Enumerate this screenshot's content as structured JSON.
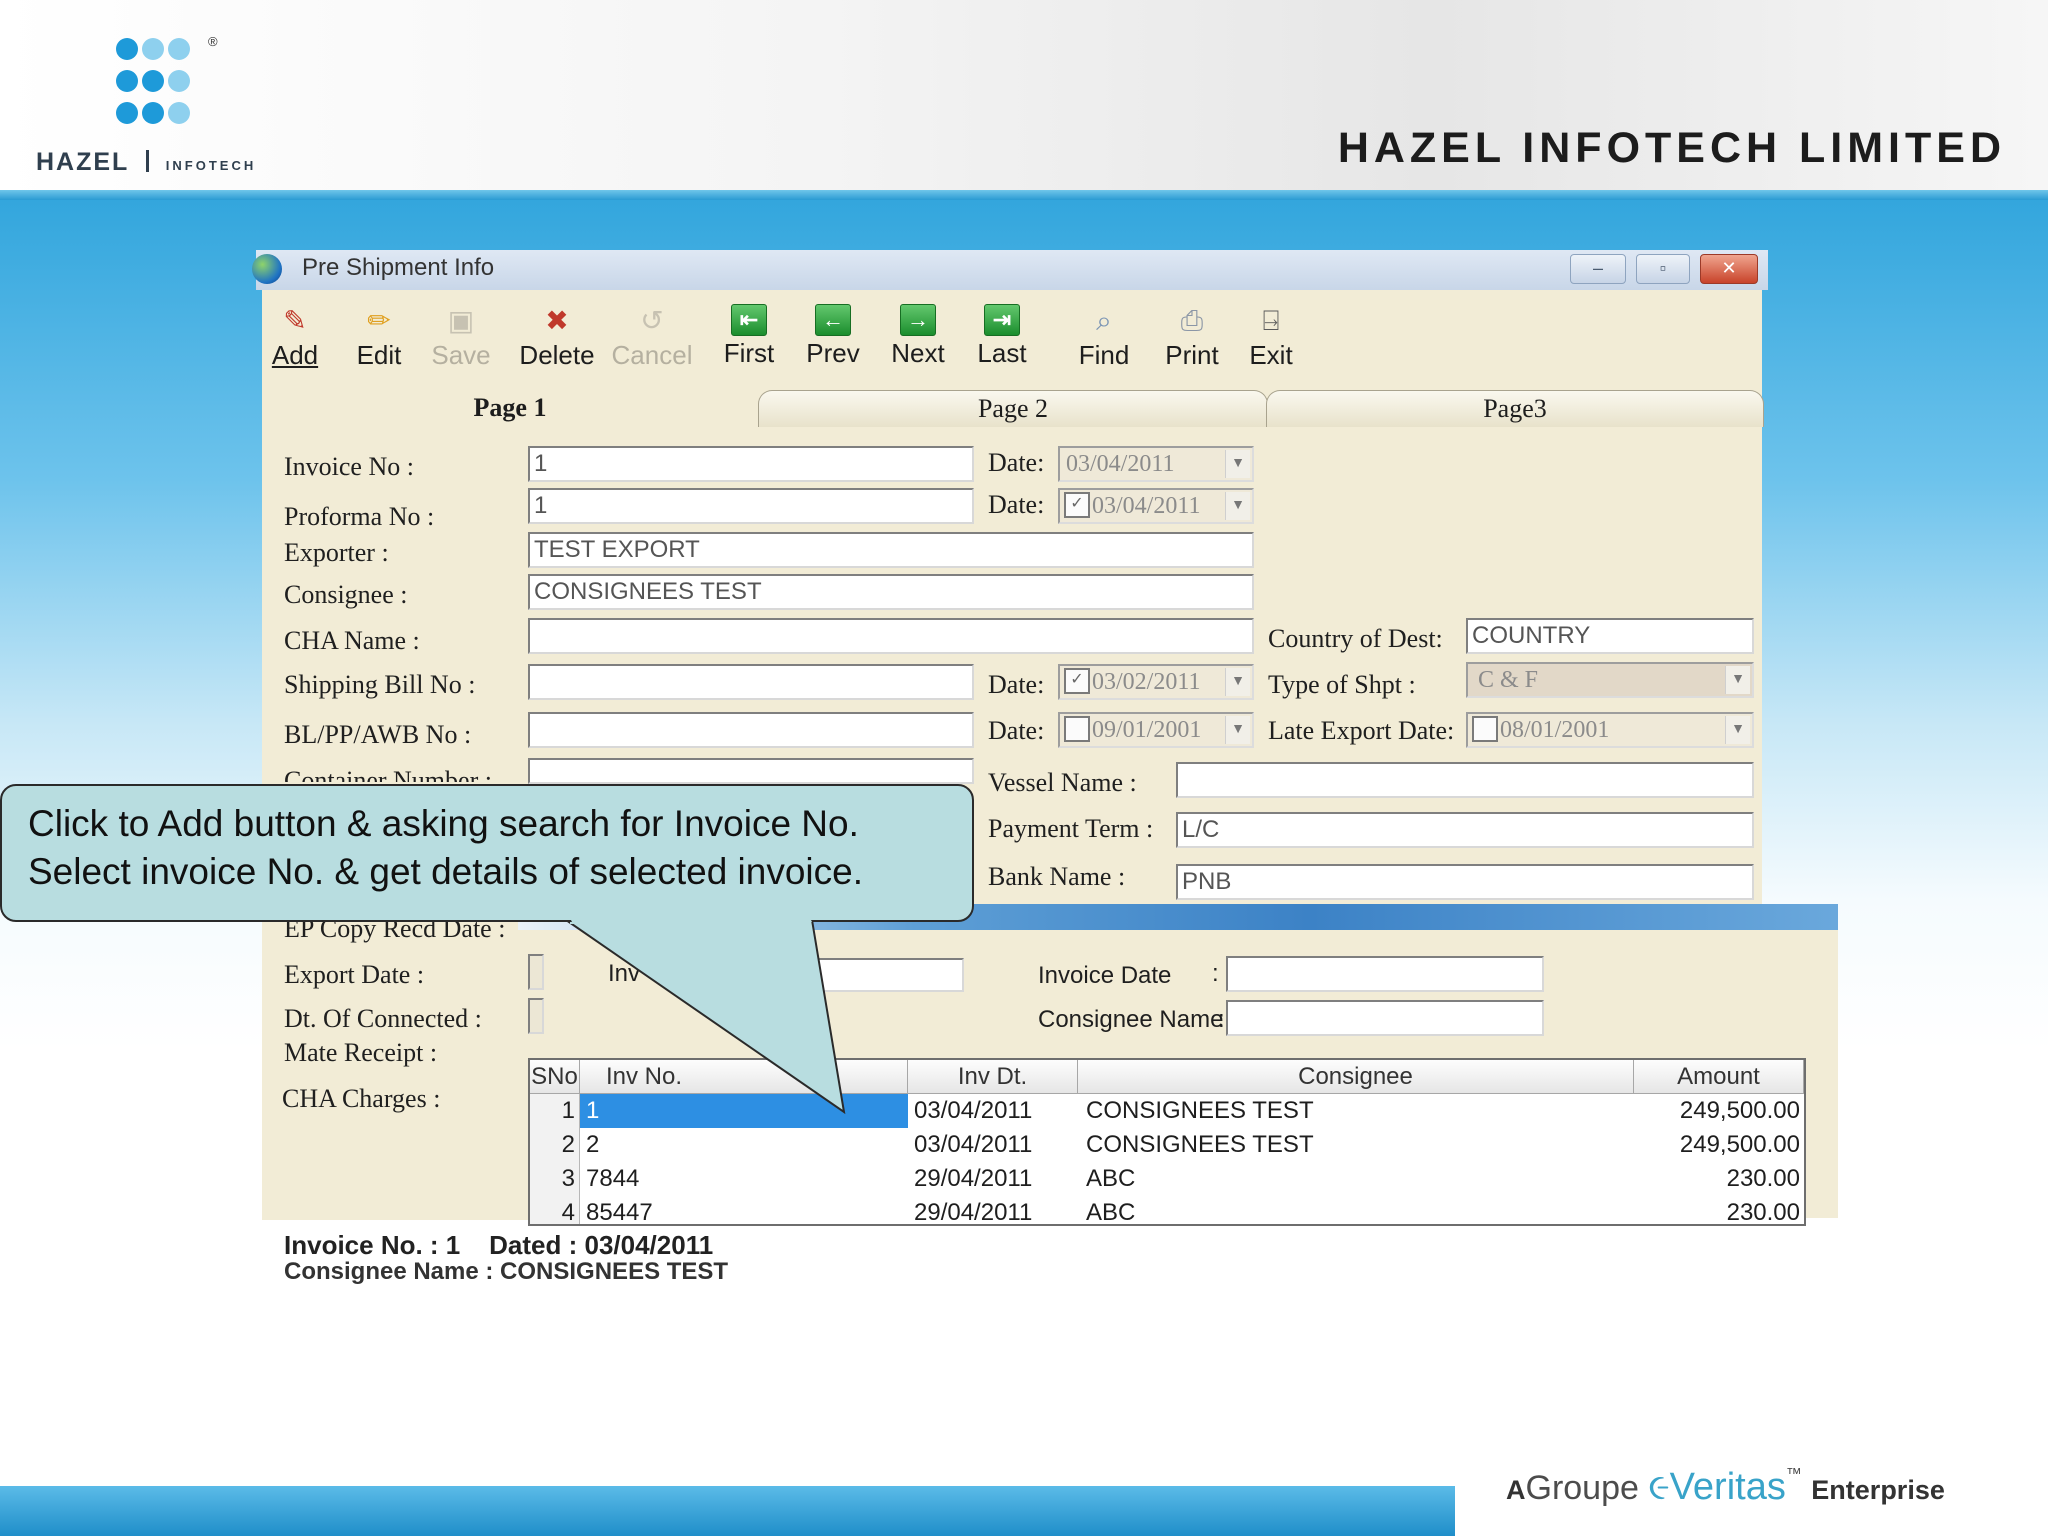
{
  "slide": {
    "logo_main": "HAZEL",
    "logo_sub": "INFOTECH",
    "logo_reg": "®",
    "company_name": "HAZEL INFOTECH LIMITED",
    "footer_prefix": "A",
    "footer_groupe": "Groupe",
    "footer_veritas": "Veritas",
    "footer_tm": "™",
    "footer_enterprise": "Enterprise"
  },
  "window": {
    "title": "Pre Shipment Info",
    "minimize": "–",
    "restore": "▫",
    "close": "✕"
  },
  "toolbar": {
    "add": "Add",
    "edit": "Edit",
    "save": "Save",
    "delete": "Delete",
    "cancel": "Cancel",
    "first": "First",
    "prev": "Prev",
    "next": "Next",
    "last": "Last",
    "find": "Find",
    "print": "Print",
    "exit": "Exit"
  },
  "tabs": {
    "page1": "Page 1",
    "page2": "Page 2",
    "page3": "Page3"
  },
  "form": {
    "invoice_no_label": "Invoice No :",
    "invoice_no": "1",
    "date_label": "Date:",
    "invoice_date": "03/04/2011",
    "proforma_no_label": "Proforma No :",
    "proforma_no": "1",
    "proforma_date": "03/04/2011",
    "exporter_label": "Exporter :",
    "exporter": "TEST EXPORT",
    "consignee_label": "Consignee :",
    "consignee": "CONSIGNEES TEST",
    "cha_name_label": "CHA Name :",
    "cha_name": "",
    "country_dest_label": "Country of Dest:",
    "country_dest": "COUNTRY",
    "shipping_bill_label": "Shipping  Bill No :",
    "shipping_bill_date": "03/02/2011",
    "type_shpt_label": "Type of Shpt :",
    "type_shpt": "C & F",
    "bl_label": "BL/PP/AWB No :",
    "bl_date": "09/01/2001",
    "late_export_label": "Late Export Date:",
    "late_export_date": "08/01/2001",
    "container_label": "Container Number :",
    "vessel_label": "Vessel Name :",
    "vessel": "",
    "payment_term_label": "Payment Term :",
    "payment_term": "L/C",
    "bank_label": "Bank Name :",
    "bank": "PNB",
    "ep_copy_label": "EP Copy Recd Date :",
    "export_date_label": "Export Date :",
    "dt_connected_label": "Dt. Of Connected :",
    "mate_receipt_label": "Mate Receipt :",
    "cha_charges_label": "CHA Charges :"
  },
  "search": {
    "inv_no_label": "Inv",
    "invoice_date_label": "Invoice Date",
    "consignee_name_label": "Consignee Name",
    "colon": ":",
    "invoice_date_value": "",
    "consignee_name_value": ""
  },
  "grid": {
    "headers": [
      "SNo",
      "Inv No.",
      "Inv Dt.",
      "Consignee",
      "Amount"
    ],
    "rows": [
      {
        "sno": "1",
        "inv_no": "1",
        "inv_dt": "03/04/2011",
        "consignee": "CONSIGNEES TEST",
        "amount": "249,500.00"
      },
      {
        "sno": "2",
        "inv_no": "2",
        "inv_dt": "03/04/2011",
        "consignee": "CONSIGNEES TEST",
        "amount": "249,500.00"
      },
      {
        "sno": "3",
        "inv_no": "7844",
        "inv_dt": "29/04/2011",
        "consignee": "ABC",
        "amount": "230.00"
      },
      {
        "sno": "4",
        "inv_no": "85447",
        "inv_dt": "29/04/2011",
        "consignee": "ABC",
        "amount": "230.00"
      }
    ]
  },
  "status": {
    "line1": "Invoice No. : 1    Dated : 03/04/2011",
    "line2": "Consignee Name : CONSIGNEES TEST"
  },
  "callout": {
    "line1": "Click to Add button & asking search for Invoice No.",
    "line2": "Select invoice No. & get details of selected invoice."
  },
  "colors": {
    "accent_blue": "#2b9bd3",
    "window_bg": "#f2ecd6",
    "selected_row": "#2d8fe3",
    "callout_bg": "#b8dde0",
    "logo_dark": "#1e9ad9",
    "logo_light": "#8ed0ee"
  }
}
